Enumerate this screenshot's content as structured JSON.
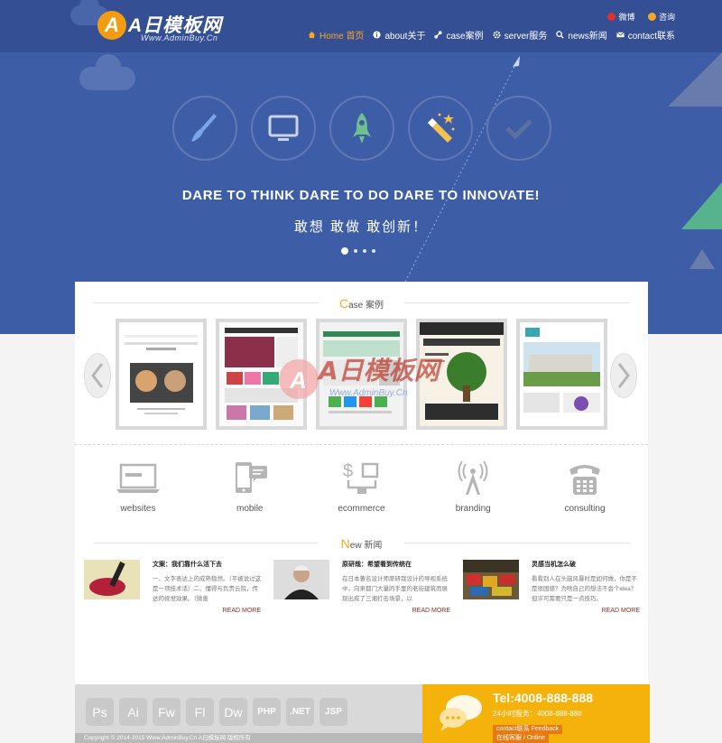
{
  "logo": {
    "badge": "A",
    "title": "A日模板网",
    "subtitle": "Www.AdminBuy.Cn"
  },
  "toplinks": [
    {
      "label": "微博",
      "icon": "weibo-icon",
      "color": "#e0322d"
    },
    {
      "label": "咨询",
      "icon": "qq-icon",
      "color": "#f5a623"
    }
  ],
  "nav": [
    {
      "label": "Home 首页",
      "icon": "home-icon",
      "active": true
    },
    {
      "label": "about关于",
      "icon": "info-icon"
    },
    {
      "label": "case案例",
      "icon": "link-icon"
    },
    {
      "label": "server服务",
      "icon": "gear-icon"
    },
    {
      "label": "news新闻",
      "icon": "search-icon"
    },
    {
      "label": "contact联系",
      "icon": "mail-icon"
    }
  ],
  "hero": {
    "icons": [
      "brush-icon",
      "monitor-icon",
      "rocket-icon",
      "magic-wand-icon",
      "check-icon"
    ],
    "headline": "DARE TO THINK DARE TO DO DARE TO INNOVATE!",
    "subline": "敢想 敢做 敢创新！",
    "slides": 4,
    "active_slide": 1
  },
  "case_section": {
    "initial": "C",
    "title": "ase",
    "cn": "案例"
  },
  "cases": [
    "case-thumb-1",
    "case-thumb-2",
    "case-thumb-3",
    "case-thumb-4",
    "case-thumb-5"
  ],
  "watermark": {
    "badge": "A",
    "title": "A日模板网",
    "subtitle": "Www.AdminBuy.Cn"
  },
  "services": [
    {
      "label": "websites",
      "icon": "laptop-icon"
    },
    {
      "label": "mobile",
      "icon": "mobile-chat-icon"
    },
    {
      "label": "ecommerce",
      "icon": "ecommerce-icon"
    },
    {
      "label": "branding",
      "icon": "antenna-icon"
    },
    {
      "label": "consulting",
      "icon": "telephone-icon"
    }
  ],
  "news_section": {
    "initial": "N",
    "title": "ew",
    "cn": "新闻"
  },
  "news": [
    {
      "title": "文案：我们靠什么活下去",
      "body": "一、文字表达上的成熟稳然。（平被说过这是一项技术活）二、懂得与负责云院，传达的视觉效果。（微善",
      "more": "READ MORE"
    },
    {
      "title": "原研哉：希望看到传统在",
      "body": "在日本著名设计师原研哉设计的导视系统中，向来都门大量的手里的老街建筑而展现出成了三湘打击场景，以",
      "more": "READ MORE"
    },
    {
      "title": "灵感当机怎么破",
      "body": "看看别人在头脑风暴时是如何做，你是不是很困惑？为啥自己的想法不会个idea？但许可需要只是一点技巧。",
      "more": "READ MORE"
    }
  ],
  "footer": {
    "tools": [
      "Ps",
      "Ai",
      "Fw",
      "Fl",
      "Dw",
      "PHP",
      ".NET",
      "JSP"
    ],
    "copyright": "Copyright © 2014-2015 Www.AdminBuy.Cn A日模板网 版权所有",
    "tel": "Tel:4008-888-888",
    "hotline": "24小时服务：4008-888-888",
    "feedback": "contact联系 Feedback",
    "online": "在线客服 / Online"
  },
  "colors": {
    "hero": "#3d5da6",
    "topbar": "#354f95",
    "accent": "#f5a623",
    "green": "#56b38d",
    "footer_yellow": "#f5b20a"
  }
}
